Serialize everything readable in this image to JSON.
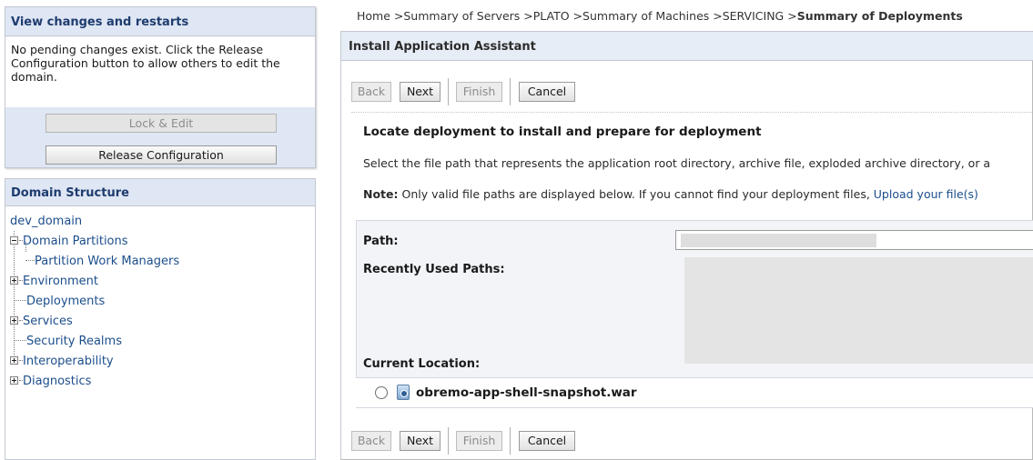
{
  "change_center": {
    "title": "View changes and restarts",
    "message": "No pending changes exist. Click the Release Configuration button to allow others to edit the domain.",
    "lock_edit_label": "Lock & Edit",
    "release_config_label": "Release Configuration"
  },
  "domain_structure": {
    "title": "Domain Structure",
    "root": "dev_domain",
    "items": [
      {
        "label": "Domain Partitions",
        "toggle": "minus",
        "level": 1
      },
      {
        "label": "Partition Work Managers",
        "toggle": "none",
        "level": 2
      },
      {
        "label": "Environment",
        "toggle": "plus",
        "level": 1
      },
      {
        "label": "Deployments",
        "toggle": "none",
        "level": 1
      },
      {
        "label": "Services",
        "toggle": "plus",
        "level": 1
      },
      {
        "label": "Security Realms",
        "toggle": "none",
        "level": 1
      },
      {
        "label": "Interoperability",
        "toggle": "plus",
        "level": 1
      },
      {
        "label": "Diagnostics",
        "toggle": "plus",
        "level": 1
      }
    ]
  },
  "breadcrumb": {
    "items": [
      "Home >",
      "Summary of Servers >",
      "PLATO >",
      "Summary of Machines >",
      "SERVICING >"
    ],
    "current": "Summary of Deployments"
  },
  "assistant": {
    "title": "Install Application Assistant",
    "buttons": {
      "back": "Back",
      "next": "Next",
      "finish": "Finish",
      "cancel": "Cancel"
    },
    "heading": "Locate deployment to install and prepare for deployment",
    "instructions": "Select the file path that represents the application root directory, archive file, exploded archive directory, or a",
    "note_label": "Note:",
    "note_text": " Only valid file paths are displayed below. If you cannot find your deployment files, ",
    "note_link": "Upload your file(s)",
    "path_label": "Path:",
    "recent_label": "Recently Used Paths:",
    "current_location_label": "Current Location:",
    "file_name": "obremo-app-shell-snapshot.war"
  },
  "colors": {
    "panel_header": "#dfe6f4",
    "link": "#1c4e8c",
    "title_text": "#1d3c6e"
  }
}
